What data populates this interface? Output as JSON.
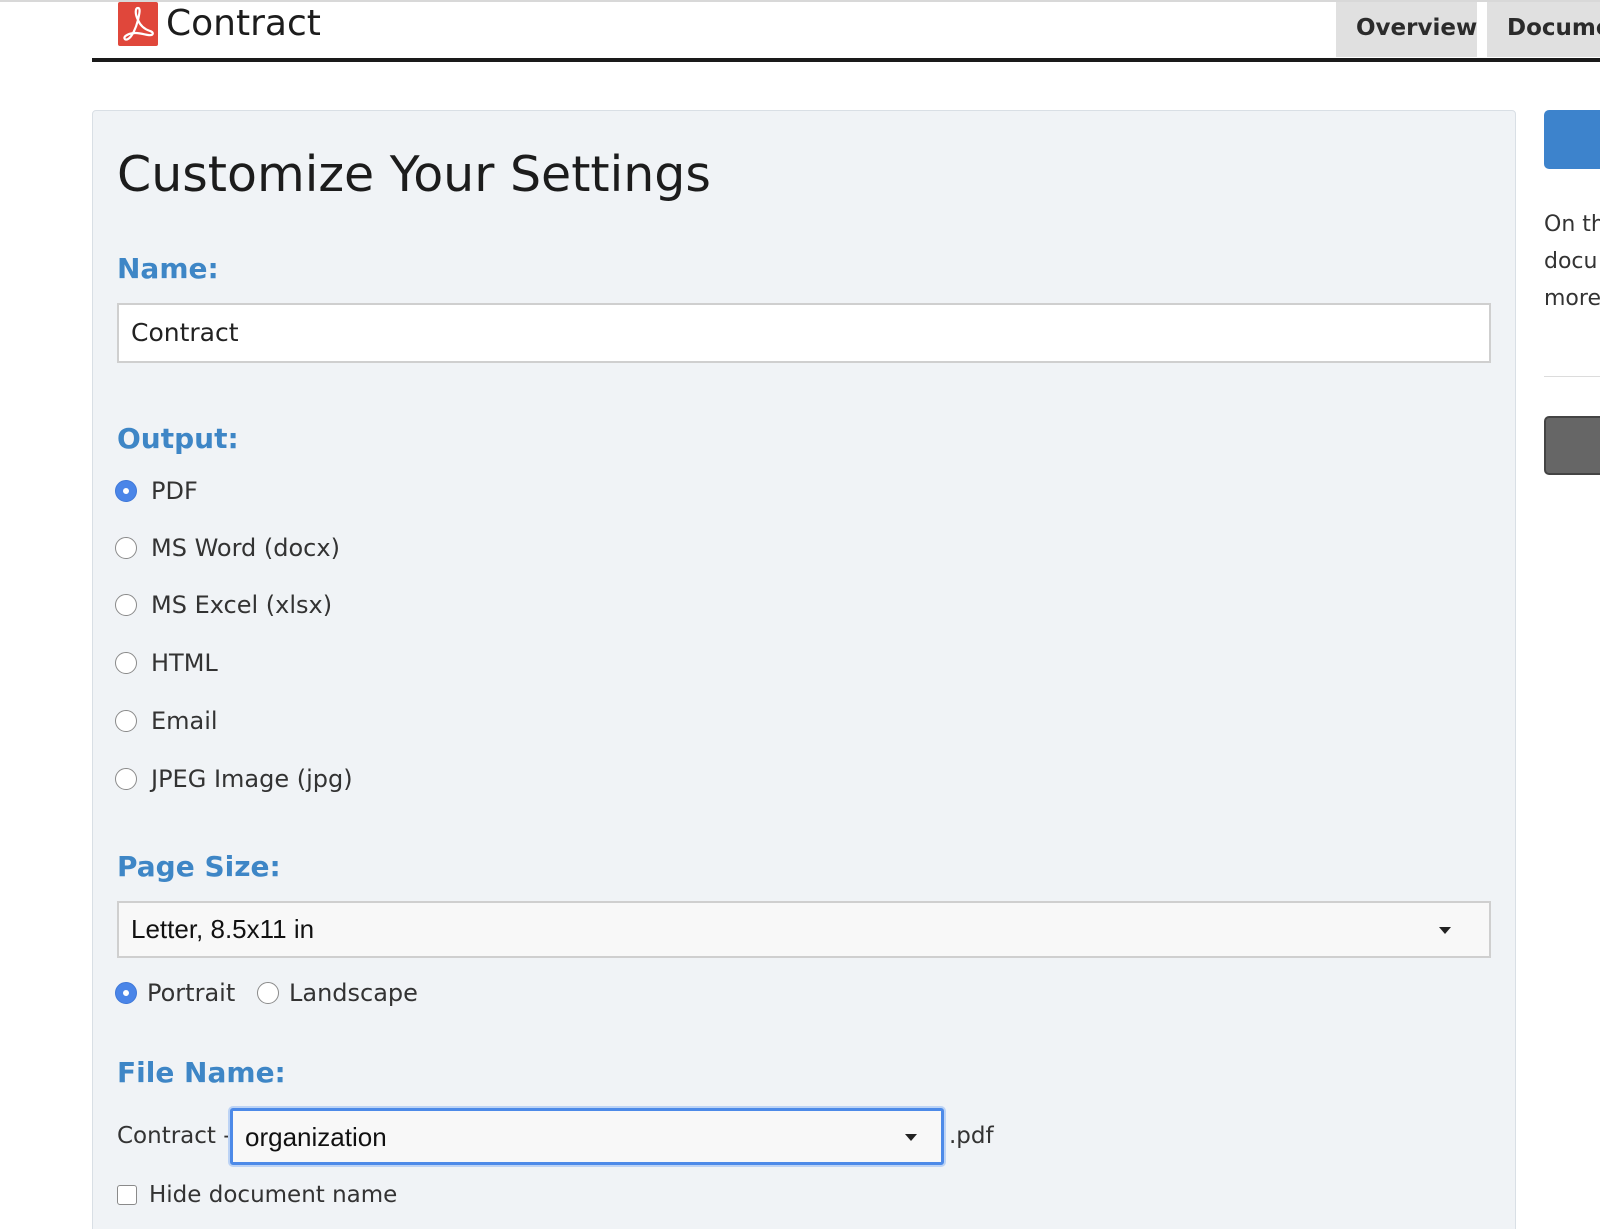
{
  "header": {
    "document_title": "Contract",
    "icon": "pdf-file-icon",
    "icon_color": "#e0473b",
    "tabs": [
      {
        "label": "Overview"
      },
      {
        "label": "Docume"
      }
    ]
  },
  "settings": {
    "title": "Customize Your Settings",
    "name_label": "Name:",
    "name_value": "Contract",
    "output_label": "Output:",
    "output_options": [
      {
        "label": "PDF",
        "checked": true
      },
      {
        "label": "MS Word (docx)",
        "checked": false
      },
      {
        "label": "MS Excel (xlsx)",
        "checked": false
      },
      {
        "label": "HTML",
        "checked": false
      },
      {
        "label": "Email",
        "checked": false
      },
      {
        "label": "JPEG Image (jpg)",
        "checked": false
      }
    ],
    "page_size_label": "Page Size:",
    "page_size_value": "Letter, 8.5x11 in",
    "orientation_options": [
      {
        "label": "Portrait",
        "checked": true
      },
      {
        "label": "Landscape",
        "checked": false
      }
    ],
    "file_name_label": "File Name:",
    "file_name_prefix": "Contract -",
    "file_name_value": "organization",
    "file_name_suffix": ".pdf",
    "hide_name_label": "Hide document name",
    "hide_name_checked": false
  },
  "sidebar": {
    "help_lines": [
      "On th",
      "docu",
      "more"
    ]
  },
  "colors": {
    "accent": "#3e86c6",
    "primary_button": "#3d83cc",
    "secondary_button": "#666666",
    "radio_checked": "#4a85e8"
  }
}
